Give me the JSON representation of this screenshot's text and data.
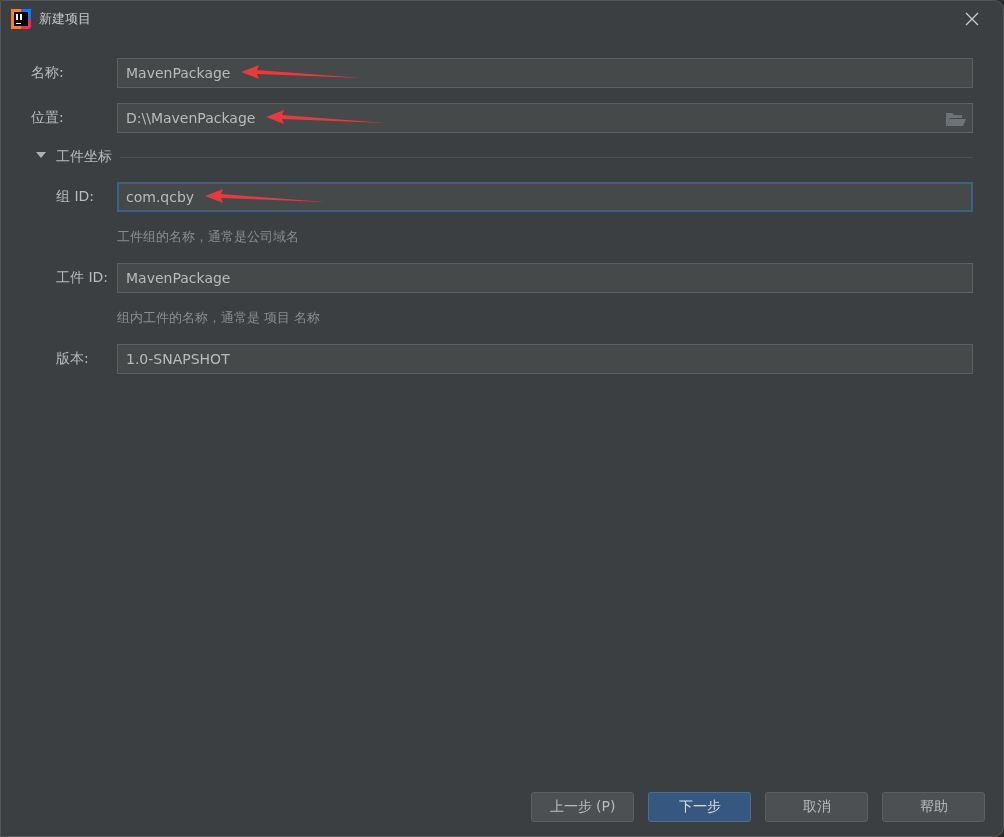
{
  "window": {
    "title": "新建项目"
  },
  "fields": [
    {
      "label": "名称:",
      "value": "MavenPackage",
      "arrow": true,
      "focused": false,
      "browse": false
    },
    {
      "label": "位置:",
      "value": "D:\\\\MavenPackage",
      "arrow": true,
      "focused": false,
      "browse": true
    }
  ],
  "section": {
    "title": "工件坐标",
    "expanded": true,
    "fields": [
      {
        "label": "组 ID:",
        "value": "com.qcby",
        "arrow": true,
        "focused": true,
        "hint": "工件组的名称，通常是公司域名"
      },
      {
        "label": "工件 ID:",
        "value": "MavenPackage",
        "arrow": false,
        "focused": false,
        "hint": "组内工件的名称，通常是 项目 名称"
      },
      {
        "label": "版本:",
        "value": "1.0-SNAPSHOT",
        "arrow": false,
        "focused": false
      }
    ]
  },
  "buttons": [
    {
      "label": "上一步 (P)",
      "primary": false
    },
    {
      "label": "下一步",
      "primary": true
    },
    {
      "label": "取消",
      "primary": false
    },
    {
      "label": "帮助",
      "primary": false
    }
  ]
}
